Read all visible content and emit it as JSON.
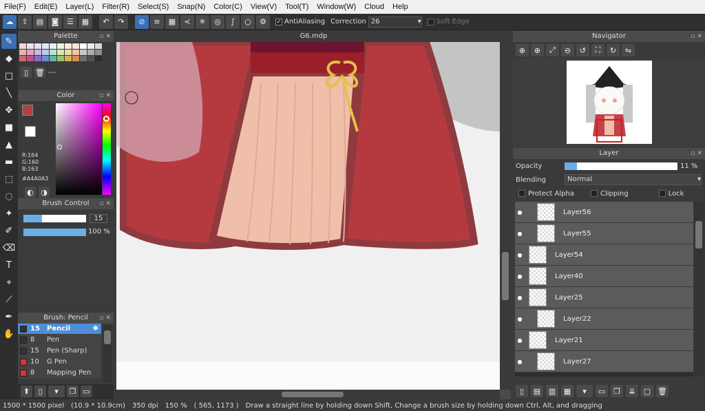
{
  "menu": [
    "File(F)",
    "Edit(E)",
    "Layer(L)",
    "Filter(R)",
    "Select(S)",
    "Snap(N)",
    "Color(C)",
    "View(V)",
    "Tool(T)",
    "Window(W)",
    "Cloud",
    "Help"
  ],
  "toolbar": {
    "antialiasing_label": "AntiAliasing",
    "correction_label": "Correction",
    "correction_value": "26",
    "soft_edge_label": "Soft Edge"
  },
  "palette": {
    "title": "Palette",
    "swatch_colors": [
      "#f5d6d6",
      "#f3e0ea",
      "#e8e0f2",
      "#dfe8f5",
      "#e3f2ec",
      "#eef3df",
      "#f6efdc",
      "#f8e4d8",
      "#ffffff",
      "#ececec",
      "#d9d9d9",
      "#e8b3b3",
      "#e2a3c3",
      "#c9b7e6",
      "#b7cbe9",
      "#b9e3cf",
      "#d7e6b5",
      "#eedcae",
      "#f0c2a8",
      "#c8c8c8",
      "#aeaeae",
      "#8f8f8f",
      "#d06666",
      "#c24f86",
      "#8a6cc9",
      "#6f8fd0",
      "#63b897",
      "#9cc264",
      "#d8b24f",
      "#d98a5a",
      "#6e6e6e",
      "#4f4f4f",
      "#2c2c2c"
    ],
    "memo": "---"
  },
  "color": {
    "title": "Color",
    "r": "R:164",
    "g": "G:160",
    "b": "B:163",
    "hex": "#A4A0A3",
    "main_color": "#b34044",
    "sub_color": "#ffffff"
  },
  "brush_control": {
    "title": "Brush Control",
    "size": "15",
    "opacity": "100 %",
    "size_fraction": 0.3,
    "opacity_fraction": 1.0
  },
  "brush_list": {
    "title": "Brush: Pencil",
    "items": [
      {
        "color": "#333333",
        "size": "15",
        "name": "Pencil",
        "selected": true
      },
      {
        "color": "#333333",
        "size": "8",
        "name": "Pen",
        "selected": false
      },
      {
        "color": "#333333",
        "size": "15",
        "name": "Pen (Sharp)",
        "selected": false
      },
      {
        "color": "#e03030",
        "size": "10",
        "name": "G Pen",
        "selected": false
      },
      {
        "color": "#e03030",
        "size": "8",
        "name": "Mapping Pen",
        "selected": false
      }
    ]
  },
  "document": {
    "tab_title": "G6.mdp"
  },
  "navigator": {
    "title": "Navigator"
  },
  "layer_panel": {
    "title": "Layer",
    "opacity_label": "Opacity",
    "opacity_value": "11 %",
    "opacity_fraction": 0.11,
    "blending_label": "Blending",
    "blending_value": "Normal",
    "protect_alpha": "Protect Alpha",
    "clipping": "Clipping",
    "lock": "Lock",
    "layers": [
      {
        "name": "Layer56",
        "indent": true
      },
      {
        "name": "Layer55",
        "indent": true
      },
      {
        "name": "Layer54",
        "indent": false
      },
      {
        "name": "Layer40",
        "indent": false
      },
      {
        "name": "Layer25",
        "indent": false
      },
      {
        "name": "Layer22",
        "indent": true
      },
      {
        "name": "Layer21",
        "indent": false
      },
      {
        "name": "Layer27",
        "indent": true
      }
    ]
  },
  "status": {
    "size": "1500 * 1500 pixel",
    "cm": "(10.9 * 10.9cm)",
    "dpi": "350 dpi",
    "zoom": "150 %",
    "coords": "( 565, 1173 )",
    "hint": "Draw a straight line by holding down Shift, Change a brush size by holding down Ctrl, Alt, and dragging"
  }
}
